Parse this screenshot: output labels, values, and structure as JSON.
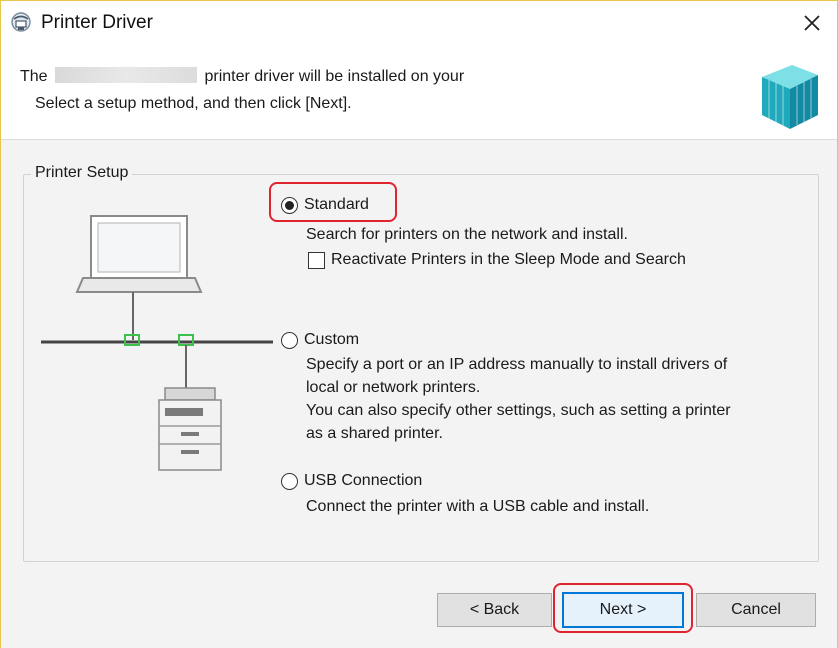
{
  "window": {
    "title": "Printer Driver",
    "icon": "printer-driver-icon",
    "close_icon": "close-icon"
  },
  "header": {
    "line1_prefix": "The",
    "line1_suffix": "printer driver will be installed on your",
    "line2": "Select a setup method, and then click [Next]."
  },
  "setup": {
    "group_label": "Printer Setup",
    "options": [
      {
        "label": "Standard",
        "selected": true,
        "description": [
          "Search for printers on the network and install."
        ],
        "checkbox_label": "Reactivate Printers in the Sleep Mode and Search",
        "checkbox_checked": false
      },
      {
        "label": "Custom",
        "selected": false,
        "description": [
          "Specify a port or an IP address manually to install drivers of",
          "local or network printers.",
          "You can also specify other settings, such as setting a printer",
          "as a shared printer."
        ]
      },
      {
        "label": "USB Connection",
        "selected": false,
        "description": [
          "Connect the printer with a USB cable and install."
        ]
      }
    ]
  },
  "buttons": {
    "back": "< Back",
    "next": "Next >",
    "cancel": "Cancel"
  },
  "colors": {
    "highlight": "#e0242f",
    "default_button_border": "#0078d7",
    "window_border": "#e7c64a",
    "product_accent": "#2bb7c9"
  }
}
